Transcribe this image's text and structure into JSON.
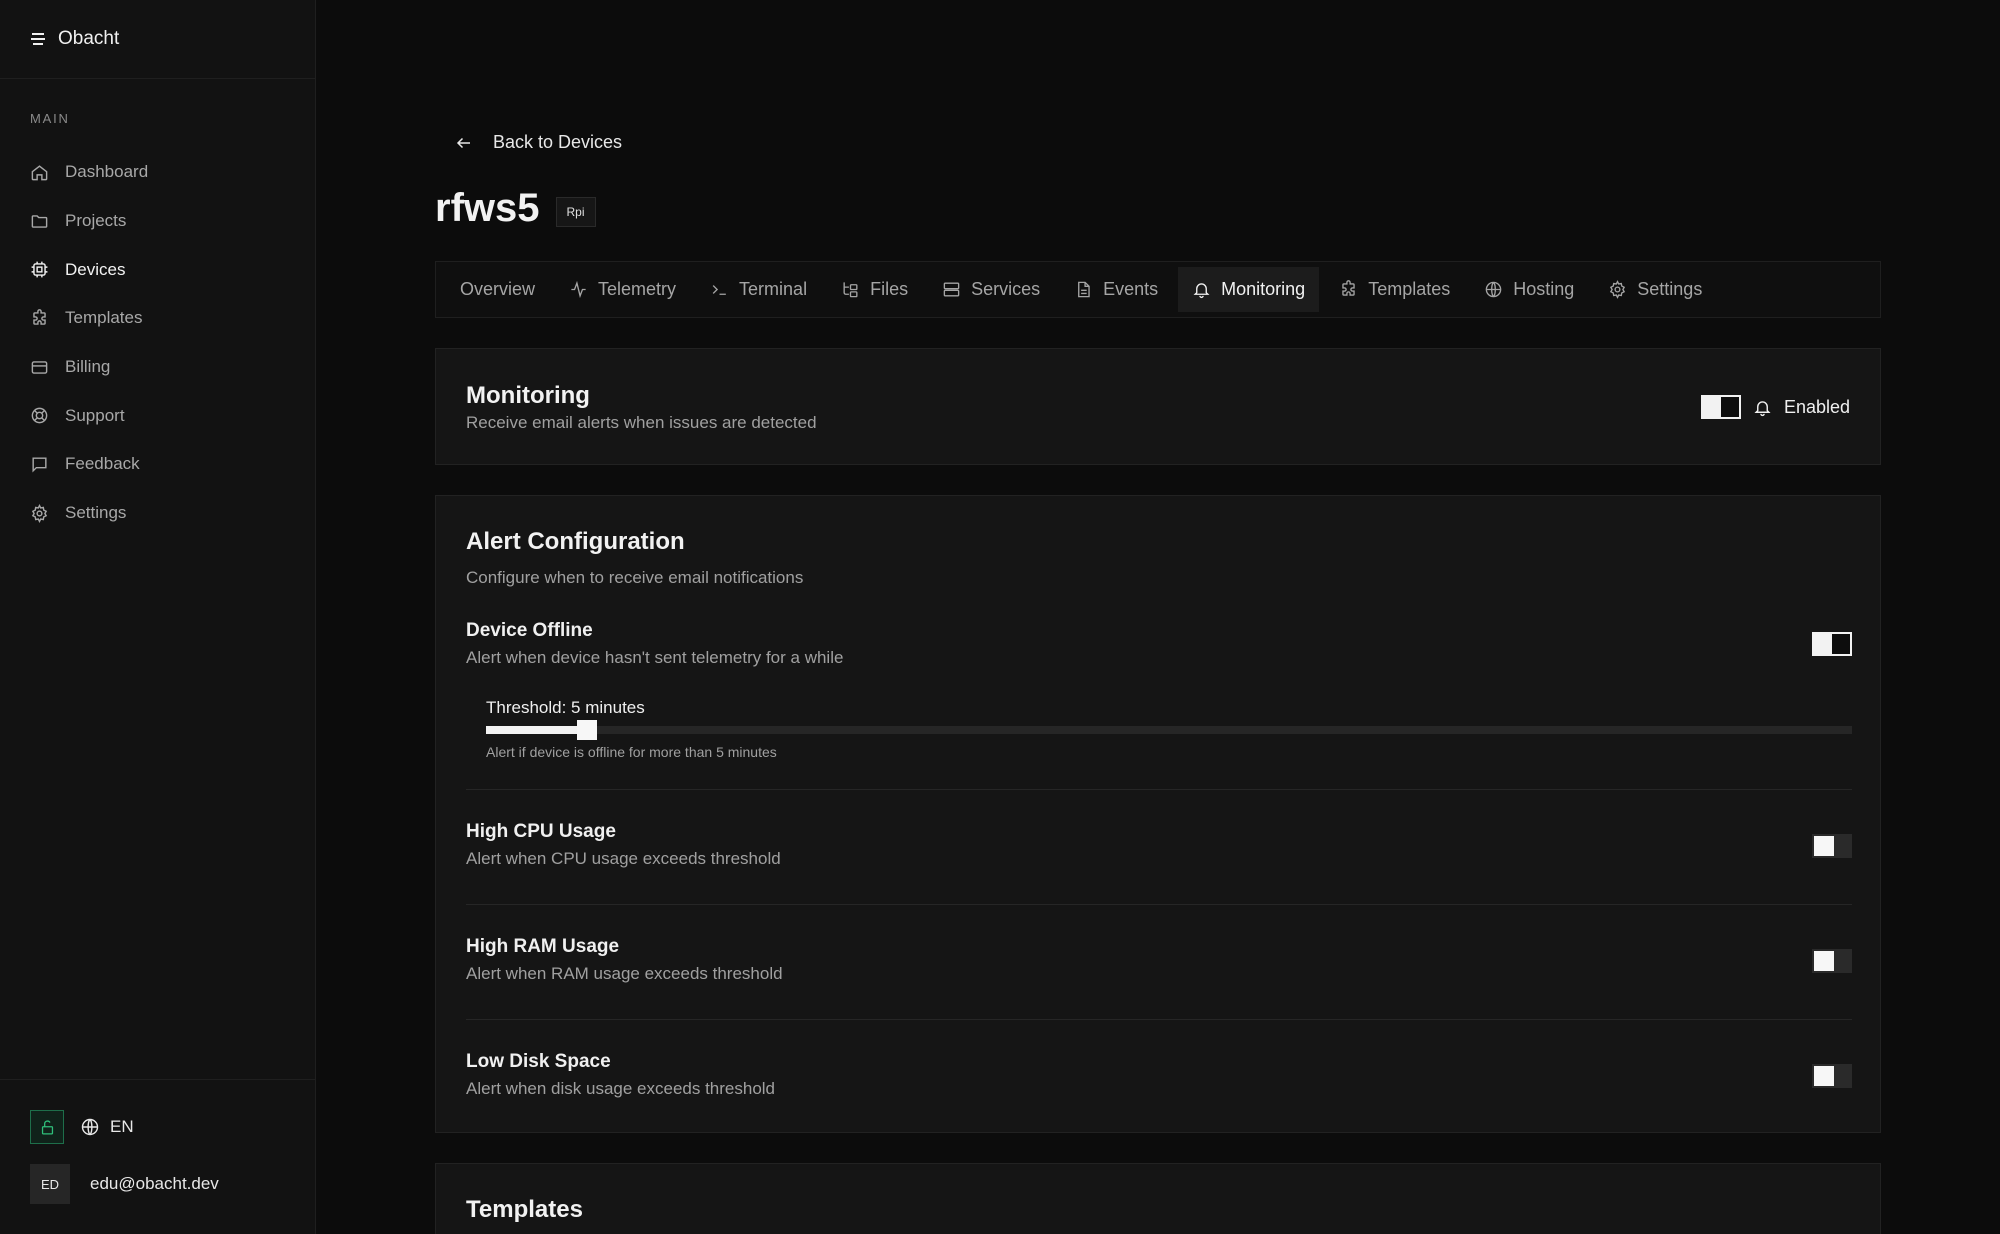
{
  "app": {
    "name": "Obacht"
  },
  "sidebar": {
    "section": "MAIN",
    "items": [
      {
        "label": "Dashboard",
        "icon": "home-icon"
      },
      {
        "label": "Projects",
        "icon": "folder-icon"
      },
      {
        "label": "Devices",
        "icon": "chip-icon",
        "active": true
      },
      {
        "label": "Templates",
        "icon": "puzzle-icon"
      },
      {
        "label": "Billing",
        "icon": "card-icon"
      },
      {
        "label": "Support",
        "icon": "lifebuoy-icon"
      },
      {
        "label": "Feedback",
        "icon": "message-icon"
      },
      {
        "label": "Settings",
        "icon": "gear-icon"
      }
    ],
    "language": "EN",
    "user": {
      "initials": "ED",
      "email": "edu@obacht.dev"
    }
  },
  "page": {
    "back_label": "Back to Devices",
    "device_name": "rfws5",
    "device_badge": "Rpi"
  },
  "tabs": [
    {
      "label": "Overview"
    },
    {
      "label": "Telemetry"
    },
    {
      "label": "Terminal"
    },
    {
      "label": "Files"
    },
    {
      "label": "Services"
    },
    {
      "label": "Events"
    },
    {
      "label": "Monitoring",
      "active": true
    },
    {
      "label": "Templates"
    },
    {
      "label": "Hosting"
    },
    {
      "label": "Settings"
    }
  ],
  "monitoring": {
    "title": "Monitoring",
    "subtitle": "Receive email alerts when issues are detected",
    "status_label": "Enabled",
    "enabled": true
  },
  "alert_config": {
    "title": "Alert Configuration",
    "subtitle": "Configure when to receive email notifications",
    "device_offline": {
      "name": "Device Offline",
      "description": "Alert when device hasn't sent telemetry for a while",
      "enabled": true,
      "threshold_label": "Threshold: 5 minutes",
      "threshold_hint": "Alert if device is offline for more than 5 minutes",
      "threshold_fraction": 0.074
    },
    "high_cpu": {
      "name": "High CPU Usage",
      "description": "Alert when CPU usage exceeds threshold",
      "enabled": false
    },
    "high_ram": {
      "name": "High RAM Usage",
      "description": "Alert when RAM usage exceeds threshold",
      "enabled": false
    },
    "low_disk": {
      "name": "Low Disk Space",
      "description": "Alert when disk usage exceeds threshold",
      "enabled": false
    }
  },
  "templates_section": {
    "title": "Templates"
  }
}
